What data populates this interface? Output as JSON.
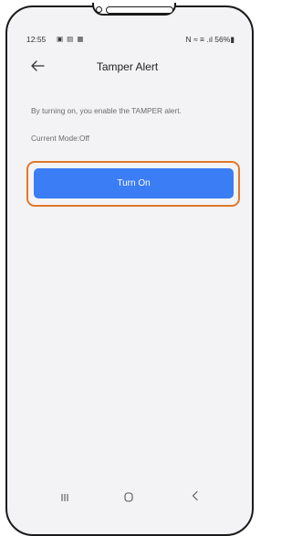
{
  "status_bar": {
    "time": "12:55",
    "left_icons": "▣ ▤ ▦",
    "right_text": "N ≈ ≡ .ıl 56%▮",
    "icons": [
      "notification-icon",
      "wifi-icon",
      "signal-icon",
      "battery-icon"
    ]
  },
  "header": {
    "title": "Tamper Alert",
    "back_icon": "arrow-left-icon"
  },
  "content": {
    "description": "By turning on, you enable the TAMPER alert.",
    "current_mode": "Current Mode:Off"
  },
  "action": {
    "turn_on_label": "Turn On",
    "button_color": "#3b7df5",
    "highlight_color": "#e0782a"
  },
  "navigation_bar": {
    "icons": [
      "recent-apps-icon",
      "home-icon",
      "back-icon"
    ]
  }
}
